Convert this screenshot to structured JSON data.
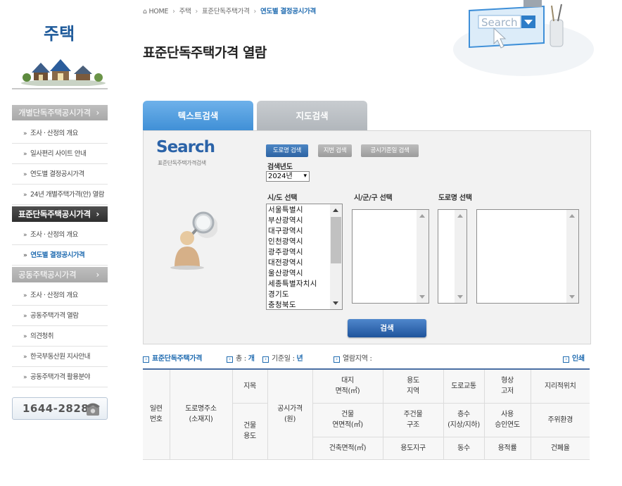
{
  "sidebar": {
    "title": "주택",
    "sections": [
      {
        "label": "개별단독주택공시가격",
        "state": "normal",
        "items": [
          {
            "label": "조사 · 산정의 개요",
            "active": false
          },
          {
            "label": "일사편리 사이트 안내",
            "active": false
          },
          {
            "label": "연도별 결정공시가격",
            "active": false
          },
          {
            "label": "24년 개별주택가격(안) 열람",
            "active": false
          }
        ]
      },
      {
        "label": "표준단독주택공시가격",
        "state": "current",
        "items": [
          {
            "label": "조사 · 산정의 개요",
            "active": false
          },
          {
            "label": "연도별 결정공시가격",
            "active": true
          }
        ]
      },
      {
        "label": "공동주택공시가격",
        "state": "normal",
        "items": [
          {
            "label": "조사 · 산정의 개요",
            "active": false
          },
          {
            "label": "공동주택가격 열람",
            "active": false
          },
          {
            "label": "의견청취",
            "active": false
          },
          {
            "label": "한국부동산원 지사안내",
            "active": false
          },
          {
            "label": "공동주택가격 활용분야",
            "active": false
          }
        ]
      }
    ],
    "phone": "1644-2828",
    "phone_icon": "telephone-icon"
  },
  "breadcrumb": {
    "home_icon": "home-icon",
    "items": [
      "HOME",
      "주택",
      "표준단독주택가격",
      "연도별 결정공시가격"
    ]
  },
  "page_title": "표준단독주택가격 열람",
  "hero": {
    "search_text": "Search"
  },
  "tabs": [
    {
      "label": "텍스트검색",
      "active": true
    },
    {
      "label": "지도검색",
      "active": false
    }
  ],
  "search_panel": {
    "logo": "Search",
    "logo_sub": "표준단독주택가격검색",
    "modes": [
      {
        "label": "도로명 검색",
        "active": true
      },
      {
        "label": "지번 검색",
        "active": false
      },
      {
        "label": "공시기준일 검색",
        "active": false
      }
    ],
    "year_label": "검색년도",
    "year_value": "2024년",
    "sido_label": "시/도 선택",
    "sigungu_label": "시/군/구 선택",
    "road_label": "도로명 선택",
    "sido_options": [
      "서울특별시",
      "부산광역시",
      "대구광역시",
      "인천광역시",
      "광주광역시",
      "대전광역시",
      "울산광역시",
      "세종특별자치시",
      "경기도",
      "충청북도"
    ],
    "search_button": "검색"
  },
  "info_bar": {
    "category": "표준단독주택가격",
    "count_label": "총 :",
    "count_value": "개",
    "date_label": "기준일 :",
    "date_value": "년",
    "region_label": "열람지역 :",
    "print_label": "인쇄"
  },
  "table": {
    "col_seq": [
      "일련",
      "번호"
    ],
    "col_addr": [
      "도로명주소",
      "(소재지)"
    ],
    "col_lot": "지목",
    "col_bldg_use": [
      "건물",
      "용도"
    ],
    "col_price": [
      "공시가격",
      "(원)"
    ],
    "r1": [
      [
        "대지",
        "면적(㎡)"
      ],
      [
        "용도",
        "지역"
      ],
      [
        "도로교통"
      ],
      [
        "형상",
        "고저"
      ],
      [
        "지리적위치"
      ]
    ],
    "r2": [
      [
        "건물",
        "연면적(㎡)"
      ],
      [
        "주건물",
        "구조"
      ],
      [
        "층수",
        "(지상/지하)"
      ],
      [
        "사용",
        "승인연도"
      ],
      [
        "주위환경"
      ]
    ],
    "r3": [
      [
        "건축면적(㎡)"
      ],
      [
        "용도지구"
      ],
      [
        "동수"
      ],
      [
        "용적률"
      ],
      [
        "건폐율"
      ]
    ]
  }
}
